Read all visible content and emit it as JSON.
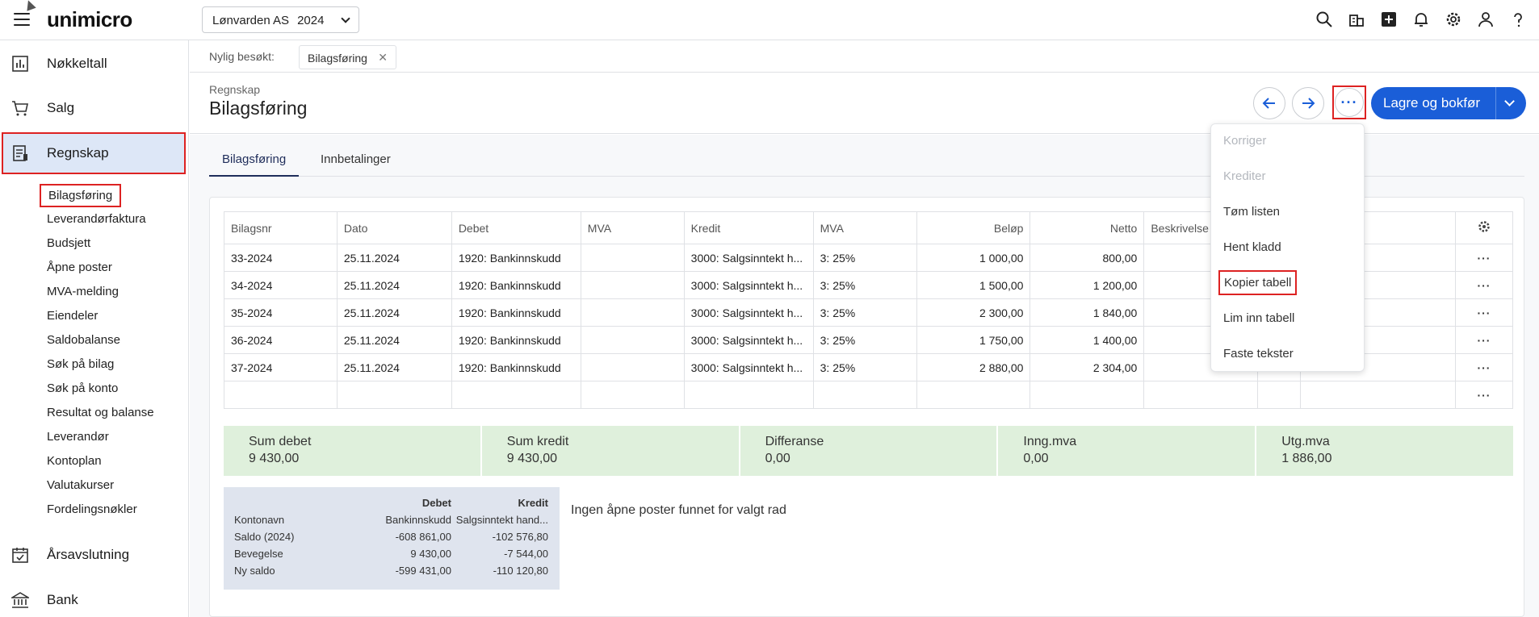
{
  "app": {
    "logo": "unimicro"
  },
  "company": {
    "name": "Lønvarden AS",
    "year": "2024"
  },
  "top_icons": [
    "search-icon",
    "building-icon",
    "plus-square-icon",
    "bell-icon",
    "gear-icon",
    "user-icon",
    "help-icon"
  ],
  "sidebar": {
    "main_items": [
      {
        "label": "Nøkkeltall",
        "icon": "bar-chart-icon"
      },
      {
        "label": "Salg",
        "icon": "cart-icon"
      },
      {
        "label": "Regnskap",
        "icon": "ledger-icon",
        "active": true
      },
      {
        "label": "Årsavslutning",
        "icon": "calendar-check-icon"
      },
      {
        "label": "Bank",
        "icon": "bank-icon"
      }
    ],
    "sub_items": [
      "Bilagsføring",
      "Leverandørfaktura",
      "Budsjett",
      "Åpne poster",
      "MVA-melding",
      "Eiendeler",
      "Saldobalanse",
      "Søk på bilag",
      "Søk på konto",
      "Resultat og balanse",
      "Leverandør",
      "Kontoplan",
      "Valutakurser",
      "Fordelingsnøkler"
    ]
  },
  "recent": {
    "label": "Nylig besøkt:",
    "tab": "Bilagsføring"
  },
  "header": {
    "breadcrumb": "Regnskap",
    "title": "Bilagsføring",
    "more_label": "···",
    "primary_label": "Lagre og bokfør"
  },
  "tabs": [
    "Bilagsføring",
    "Innbetalinger"
  ],
  "table": {
    "columns": [
      "Bilagsnr",
      "Dato",
      "Debet",
      "MVA",
      "Kredit",
      "MVA",
      "Beløp",
      "Netto",
      "Beskrivelse"
    ],
    "rows": [
      [
        "33-2024",
        "25.11.2024",
        "1920: Bankinnskudd",
        "",
        "3000: Salgsinntekt h...",
        "3: 25%",
        "1 000,00",
        "800,00",
        ""
      ],
      [
        "34-2024",
        "25.11.2024",
        "1920: Bankinnskudd",
        "",
        "3000: Salgsinntekt h...",
        "3: 25%",
        "1 500,00",
        "1 200,00",
        ""
      ],
      [
        "35-2024",
        "25.11.2024",
        "1920: Bankinnskudd",
        "",
        "3000: Salgsinntekt h...",
        "3: 25%",
        "2 300,00",
        "1 840,00",
        ""
      ],
      [
        "36-2024",
        "25.11.2024",
        "1920: Bankinnskudd",
        "",
        "3000: Salgsinntekt h...",
        "3: 25%",
        "1 750,00",
        "1 400,00",
        ""
      ],
      [
        "37-2024",
        "25.11.2024",
        "1920: Bankinnskudd",
        "",
        "3000: Salgsinntekt h...",
        "3: 25%",
        "2 880,00",
        "2 304,00",
        ""
      ]
    ],
    "row_menu": "···"
  },
  "sums": [
    {
      "label": "Sum debet",
      "value": "9 430,00"
    },
    {
      "label": "Sum kredit",
      "value": "9 430,00"
    },
    {
      "label": "Differanse",
      "value": "0,00"
    },
    {
      "label": "Inng.mva",
      "value": "0,00"
    },
    {
      "label": "Utg.mva",
      "value": "1 886,00"
    }
  ],
  "account_info": {
    "header_debet": "Debet",
    "header_kredit": "Kredit",
    "rows": [
      {
        "label": "Kontonavn",
        "debet": "Bankinnskudd",
        "kredit": "Salgsinntekt hand..."
      },
      {
        "label": "Saldo (2024)",
        "debet": "-608 861,00",
        "kredit": "-102 576,80"
      },
      {
        "label": "Bevegelse",
        "debet": "9 430,00",
        "kredit": "-7 544,00"
      },
      {
        "label": "Ny saldo",
        "debet": "-599 431,00",
        "kredit": "-110 120,80"
      }
    ]
  },
  "no_open_posts": "Ingen åpne poster funnet for valgt rad",
  "menu": {
    "items": [
      {
        "label": "Korriger",
        "disabled": true
      },
      {
        "label": "Krediter",
        "disabled": true
      },
      {
        "label": "Tøm listen",
        "disabled": false
      },
      {
        "label": "Hent kladd",
        "disabled": false
      },
      {
        "label": "Kopier tabell",
        "disabled": false,
        "highlighted": true
      },
      {
        "label": "Lim inn tabell",
        "disabled": false
      },
      {
        "label": "Faste tekster",
        "disabled": false
      }
    ]
  },
  "colors": {
    "accent": "#1a5ed8",
    "active_nav_bg": "#dde7f7",
    "highlight_border": "#dd2222",
    "sums_bg": "#dff0dc",
    "account_bg": "#dfe4ee"
  }
}
